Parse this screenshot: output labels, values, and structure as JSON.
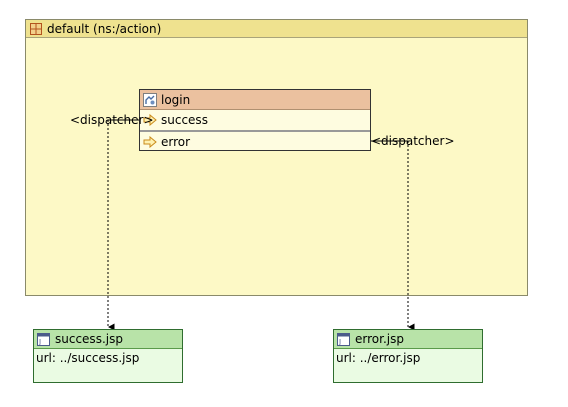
{
  "package": {
    "title": "default (ns:/action)"
  },
  "action": {
    "name": "login",
    "results": [
      {
        "label": "success"
      },
      {
        "label": "error"
      }
    ]
  },
  "connections": [
    {
      "label": "<dispatcher>"
    },
    {
      "label": "<dispatcher>"
    }
  ],
  "views": [
    {
      "name": "success.jsp",
      "url": "url: ../success.jsp"
    },
    {
      "name": "error.jsp",
      "url": "url: ../error.jsp"
    }
  ]
}
